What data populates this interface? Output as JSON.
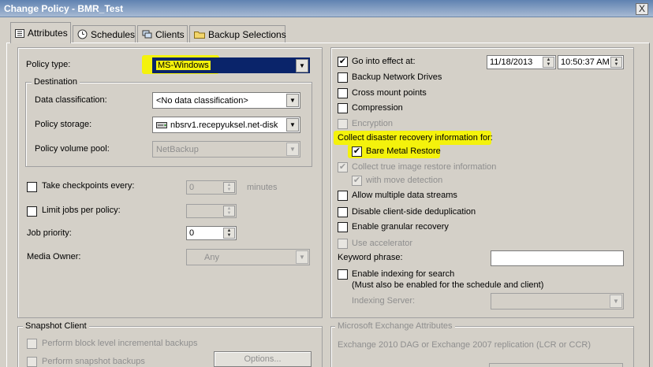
{
  "window": {
    "title": "Change Policy - BMR_Test",
    "close_label": "X"
  },
  "tabs": [
    {
      "label": "Attributes",
      "icon": "attributes-icon"
    },
    {
      "label": "Schedules",
      "icon": "schedules-icon"
    },
    {
      "label": "Clients",
      "icon": "clients-icon"
    },
    {
      "label": "Backup Selections",
      "icon": "folder-icon"
    }
  ],
  "left": {
    "policy_type_label": "Policy type:",
    "policy_type_value": "MS-Windows",
    "destination": {
      "group_label": "Destination",
      "data_classification_label": "Data classification:",
      "data_classification_value": "<No data classification>",
      "policy_storage_label": "Policy storage:",
      "policy_storage_value": "nbsrv1.recepyuksel.net-disk",
      "policy_volume_pool_label": "Policy volume pool:",
      "policy_volume_pool_value": "NetBackup"
    },
    "take_checkpoints_label": "Take checkpoints every:",
    "take_checkpoints_value": "0",
    "minutes_label": "minutes",
    "limit_jobs_label": "Limit jobs per policy:",
    "limit_jobs_value": "",
    "job_priority_label": "Job priority:",
    "job_priority_value": "0",
    "media_owner_label": "Media Owner:",
    "media_owner_value": "Any"
  },
  "right": {
    "go_into_effect_label": "Go into effect at:",
    "date_value": "11/18/2013",
    "time_value": "10:50:37 AM",
    "backup_network_drives_label": "Backup Network Drives",
    "cross_mount_points_label": "Cross mount points",
    "compression_label": "Compression",
    "encryption_label": "Encryption",
    "collect_dr_label": "Collect disaster recovery information for:",
    "bare_metal_restore_label": "Bare Metal Restore",
    "collect_tir_label": "Collect true image restore information",
    "with_move_detection_label": "with move detection",
    "multiple_streams_label": "Allow multiple data streams",
    "disable_dedup_label": "Disable client-side deduplication",
    "granular_recovery_label": "Enable granular recovery",
    "use_accelerator_label": "Use accelerator",
    "keyword_phrase_label": "Keyword phrase:",
    "keyword_phrase_value": "",
    "enable_indexing_label": "Enable indexing for search",
    "enable_indexing_note": "(Must also be enabled for the schedule and client)",
    "indexing_server_label": "Indexing Server:",
    "indexing_server_value": ""
  },
  "snapshot": {
    "group_label": "Snapshot Client",
    "block_level_label": "Perform block level incremental backups",
    "snapshot_backups_label": "Perform snapshot backups",
    "options_label": "Options..."
  },
  "exchange": {
    "group_label": "Microsoft Exchange Attributes",
    "dag_label": "Exchange 2010 DAG or Exchange 2007 replication (LCR or CCR)"
  },
  "colors": {
    "highlight": "#f4f20c",
    "selection": "#0a246a",
    "titlebar": "#5f82b1"
  }
}
